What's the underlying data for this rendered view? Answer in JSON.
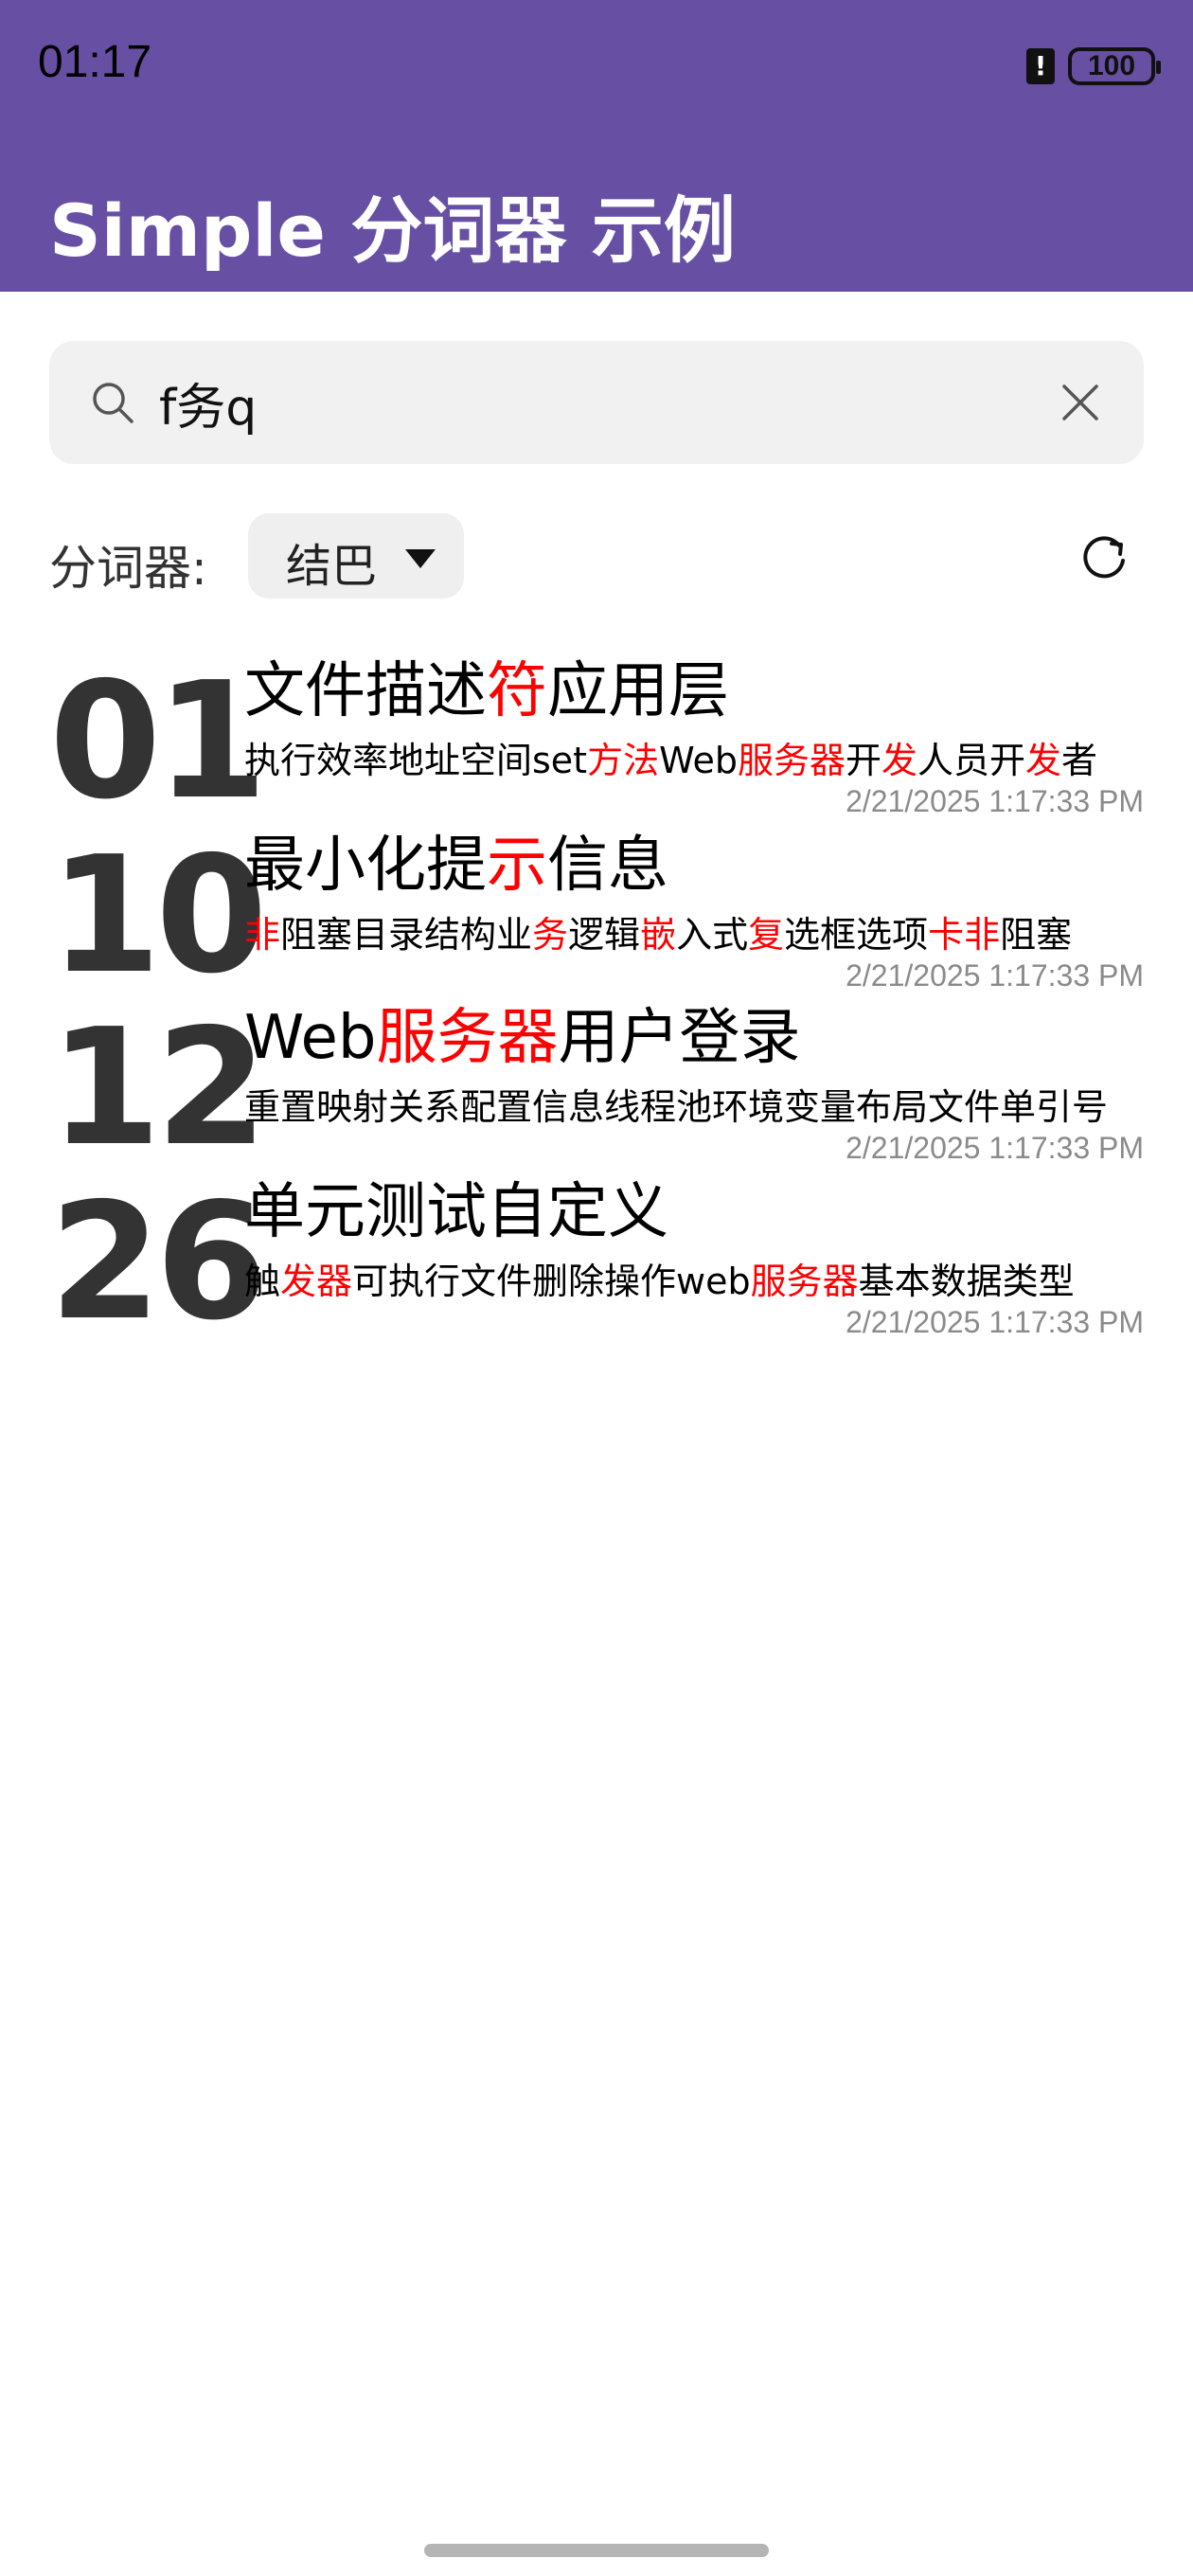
{
  "status_bar": {
    "time": "01:17",
    "battery": "100"
  },
  "app_bar": {
    "title": "Simple 分词器 示例"
  },
  "search": {
    "value": "f务q"
  },
  "tokenizer": {
    "label": "分词器:",
    "selected": "结巴"
  },
  "results": [
    {
      "number": "01",
      "title": [
        {
          "t": "文件描述"
        },
        {
          "t": "符",
          "hl": true
        },
        {
          "t": "应用层"
        }
      ],
      "snippet": [
        {
          "t": "执行效率地址空间set"
        },
        {
          "t": "方法",
          "hl": true
        },
        {
          "t": "Web"
        },
        {
          "t": "服务器",
          "hl": true
        },
        {
          "t": "开"
        },
        {
          "t": "发",
          "hl": true
        },
        {
          "t": "人员开"
        },
        {
          "t": "发",
          "hl": true
        },
        {
          "t": "者"
        }
      ],
      "time": "2/21/2025  1:17:33 PM"
    },
    {
      "number": "10",
      "title": [
        {
          "t": "最小化提"
        },
        {
          "t": "示",
          "hl": true
        },
        {
          "t": "信息"
        }
      ],
      "snippet": [
        {
          "t": "非",
          "hl": true
        },
        {
          "t": "阻塞目录结构业"
        },
        {
          "t": "务",
          "hl": true
        },
        {
          "t": "逻辑"
        },
        {
          "t": "嵌",
          "hl": true
        },
        {
          "t": "入式"
        },
        {
          "t": "复",
          "hl": true
        },
        {
          "t": "选框选项"
        },
        {
          "t": "卡非",
          "hl": true
        },
        {
          "t": "阻塞"
        }
      ],
      "time": "2/21/2025  1:17:33 PM"
    },
    {
      "number": "12",
      "title": [
        {
          "t": "Web"
        },
        {
          "t": "服务器",
          "hl": true
        },
        {
          "t": "用户登录"
        }
      ],
      "snippet": [
        {
          "t": "重置映射关系配置信息线程池环境变量布局文件单引号"
        }
      ],
      "time": "2/21/2025  1:17:33 PM"
    },
    {
      "number": "26",
      "title": [
        {
          "t": "单元测试自定义"
        }
      ],
      "snippet": [
        {
          "t": "触"
        },
        {
          "t": "发器",
          "hl": true
        },
        {
          "t": "可执行文件删除操作web"
        },
        {
          "t": "服务器",
          "hl": true
        },
        {
          "t": "基本数据类型"
        }
      ],
      "time": "2/21/2025  1:17:33 PM"
    }
  ],
  "colors": {
    "app_bar": "#6750A4",
    "highlight": "#FF0000",
    "timestamp": "#8A8A8A"
  }
}
